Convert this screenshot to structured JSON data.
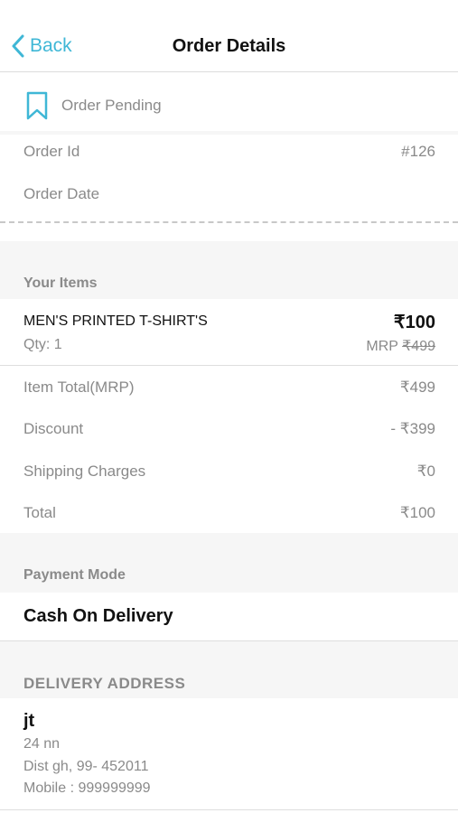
{
  "nav": {
    "back_label": "Back",
    "title": "Order Details"
  },
  "status": {
    "icon": "bookmark-icon",
    "label": "Order Pending",
    "accent": "#3fb7d6"
  },
  "order": {
    "id_label": "Order Id",
    "id_value": "#126",
    "date_label": "Order Date",
    "date_value": ""
  },
  "items_section": {
    "heading": "Your Items",
    "items": [
      {
        "name": "MEN'S PRINTED T-SHIRT'S",
        "price": "₹100",
        "qty": "Qty: 1",
        "mrp_label": "MRP",
        "mrp_value": "₹499"
      }
    ]
  },
  "summary": {
    "item_total_label": "Item Total(MRP)",
    "item_total_value": "₹499",
    "discount_label": "Discount",
    "discount_value": "- ₹399",
    "shipping_label": "Shipping Charges",
    "shipping_value": "₹0",
    "total_label": "Total",
    "total_value": "₹100"
  },
  "payment": {
    "heading": "Payment Mode",
    "value": "Cash On Delivery"
  },
  "address": {
    "heading": "DELIVERY ADDRESS",
    "name": "jt",
    "line1": "24 nn",
    "line2": "Dist gh, 99- 452011",
    "mobile": "Mobile : 999999999"
  }
}
